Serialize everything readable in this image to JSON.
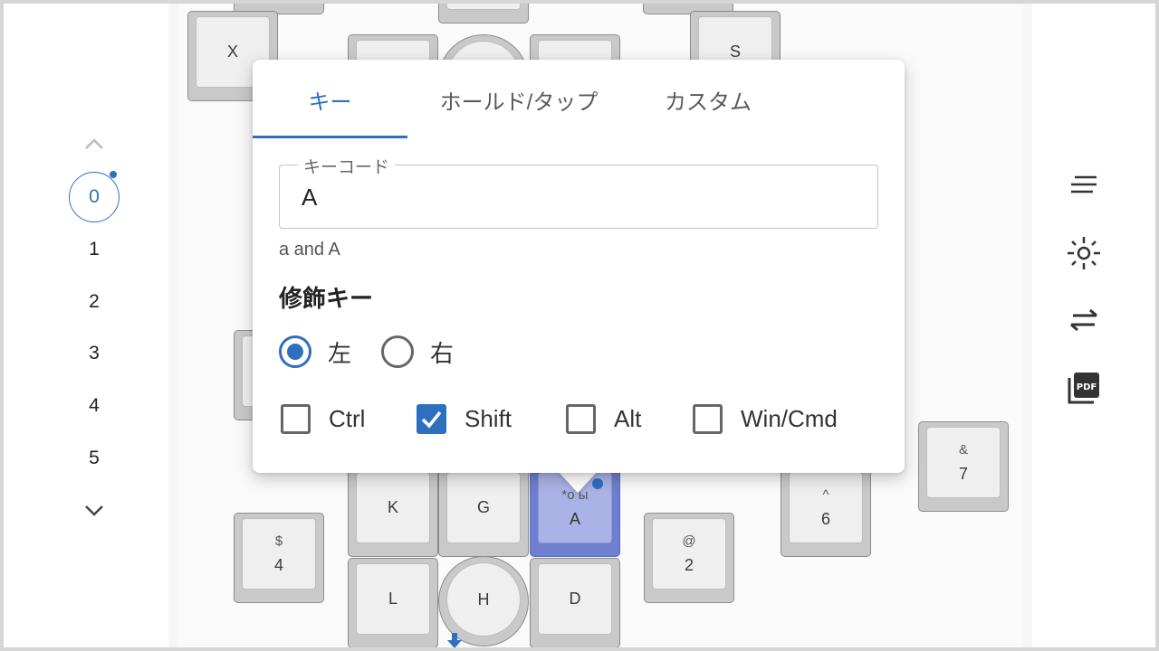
{
  "layers": {
    "items": [
      "0",
      "1",
      "2",
      "3",
      "4",
      "5"
    ],
    "active": "0"
  },
  "keys": {
    "x": "X",
    "s": "S",
    "k": "K",
    "g": "G",
    "a": "A",
    "a_shift": "*o ы",
    "h": "H",
    "l": "L",
    "d": "D",
    "four": {
      "top": "$",
      "bottom": "4"
    },
    "two": {
      "top": "@",
      "bottom": "2"
    },
    "six": {
      "top": "^",
      "bottom": "6"
    },
    "seven": {
      "top": "&",
      "bottom": "7"
    }
  },
  "popup": {
    "tabs": [
      "キー",
      "ホールド/タップ",
      "カスタム"
    ],
    "keycode_label": "キーコード",
    "keycode_value": "A",
    "helper": "a and A",
    "modifiers_title": "修飾キー",
    "side_left": "左",
    "side_right": "右",
    "mods": [
      "Ctrl",
      "Shift",
      "Alt",
      "Win/Cmd"
    ]
  },
  "toolbar": {
    "icons": [
      "menu-lines-icon",
      "brightness-icon",
      "swap-arrows-icon",
      "pdf-icon"
    ]
  },
  "colors": {
    "accent": "#2f6fbf",
    "selected_key": "#6f7fcf"
  }
}
